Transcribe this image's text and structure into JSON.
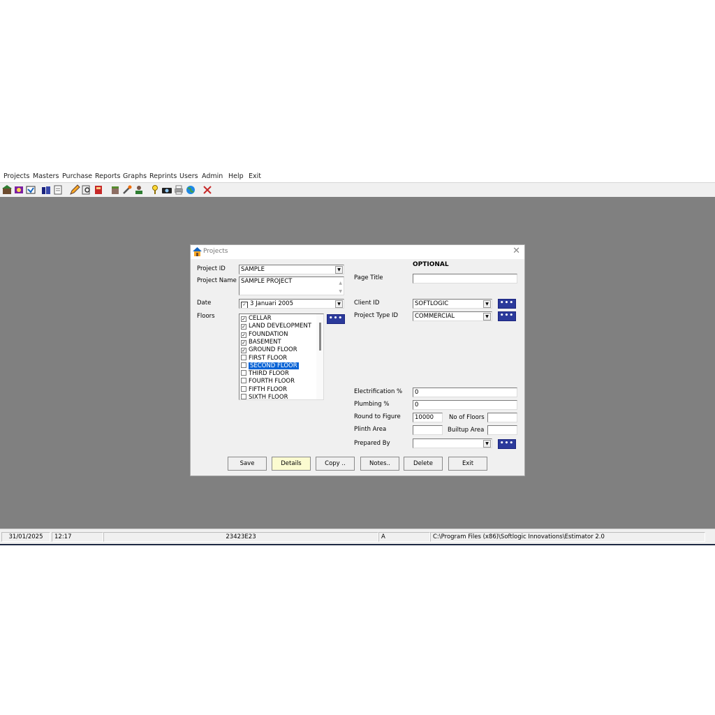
{
  "menu": [
    "Projects",
    "Masters",
    "Purchase",
    "Reports",
    "Graphs",
    "Reprints",
    "Users",
    "Admin",
    "Help",
    "Exit"
  ],
  "toolbar_icons": [
    "projects-icon",
    "masters-icon",
    "purchase-icon",
    "reports-icon",
    "notes-icon",
    "edit-icon",
    "search-icon",
    "book-icon",
    "box-icon",
    "tools-icon",
    "users-icon",
    "key-icon",
    "camera-icon",
    "printer-icon",
    "globe-icon",
    "close-icon"
  ],
  "dialog": {
    "title": "Projects",
    "project_id_label": "Project ID",
    "project_id_value": "SAMPLE",
    "project_name_label": "Project Name",
    "project_name_value": "SAMPLE PROJECT",
    "date_label": "Date",
    "date_value": "3   Januari   2005",
    "floors_label": "Floors",
    "floors": [
      {
        "label": "CELLAR",
        "checked": true
      },
      {
        "label": "LAND DEVELOPMENT",
        "checked": true
      },
      {
        "label": "FOUNDATION",
        "checked": true
      },
      {
        "label": "BASEMENT",
        "checked": true
      },
      {
        "label": "GROUND FLOOR",
        "checked": true
      },
      {
        "label": "FIRST FLOOR",
        "checked": false
      },
      {
        "label": "SECOND FLOOR",
        "checked": false,
        "selected": true
      },
      {
        "label": "THIRD FLOOR",
        "checked": false
      },
      {
        "label": "FOURTH FLOOR",
        "checked": false
      },
      {
        "label": "FIFTH FLOOR",
        "checked": false
      },
      {
        "label": "SIXTH FLOOR",
        "checked": false
      }
    ],
    "optional_heading": "OPTIONAL",
    "page_title_label": "Page Title",
    "page_title_value": "",
    "client_id_label": "Client ID",
    "client_id_value": "SOFTLOGIC",
    "project_type_label": "Project Type ID",
    "project_type_value": "COMMERCIAL",
    "electrification_label": "Electrification %",
    "electrification_value": "0",
    "plumbing_label": "Plumbing %",
    "plumbing_value": "0",
    "round_label": "Round to Figure",
    "round_value": "10000",
    "no_floors_label": "No of Floors",
    "no_floors_value": "",
    "plinth_label": "Plinth Area",
    "plinth_value": "",
    "builtup_label": "Builtup Area",
    "builtup_value": "",
    "prepared_label": "Prepared By",
    "prepared_value": "",
    "dots": "•••",
    "buttons": {
      "save": "Save",
      "details": "Details",
      "copy": "Copy ..",
      "notes": "Notes..",
      "delete": "Delete",
      "exit": "Exit"
    }
  },
  "status": {
    "date": "31/01/2025",
    "time": "12:17",
    "code": "23423E23",
    "drive": "A",
    "path": "C:\\Program Files (x86)\\Softlogic Innovations\\Estimator 2.0"
  }
}
